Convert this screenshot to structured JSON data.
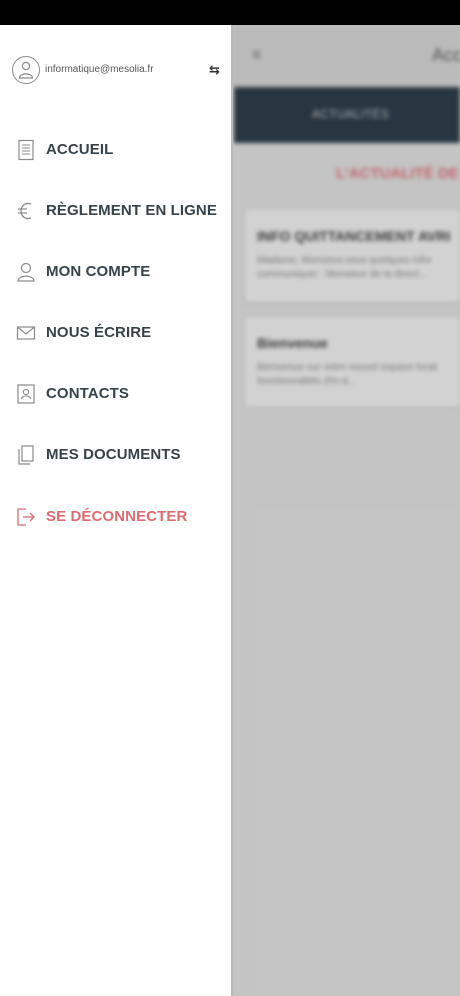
{
  "drawer": {
    "user_email": "informatique@mesolia.fr",
    "items": [
      {
        "label": "ACCUEIL",
        "icon": "document-list-icon"
      },
      {
        "label": "RÈGLEMENT EN LIGNE",
        "icon": "euro-icon"
      },
      {
        "label": "MON COMPTE",
        "icon": "user-icon"
      },
      {
        "label": "NOUS ÉCRIRE",
        "icon": "envelope-icon"
      },
      {
        "label": "CONTACTS",
        "icon": "contact-card-icon"
      },
      {
        "label": "MES DOCUMENTS",
        "icon": "documents-icon"
      },
      {
        "label": "SE DÉCONNECTER",
        "icon": "logout-icon"
      }
    ]
  },
  "background": {
    "header_title": "Acc",
    "tab": "ACTUALITÉS",
    "section_title": "L'ACTUALITÉ DE V",
    "cards": [
      {
        "title": "INFO QUITTANCEMENT AVRI",
        "text_line1": "Madame, Monsieur,nous quelques infor",
        "text_line2": "communiquer : Monsieur de la direct..."
      },
      {
        "title": "Bienvenue",
        "text_line1": "Bienvenue sur votre nouvel espace locat",
        "text_line2": "fonctionnalités d'in-d..."
      }
    ]
  },
  "colors": {
    "accent_logout": "#de6b72",
    "tabbar": "#2f3f4b",
    "menu_text": "#37434b"
  }
}
